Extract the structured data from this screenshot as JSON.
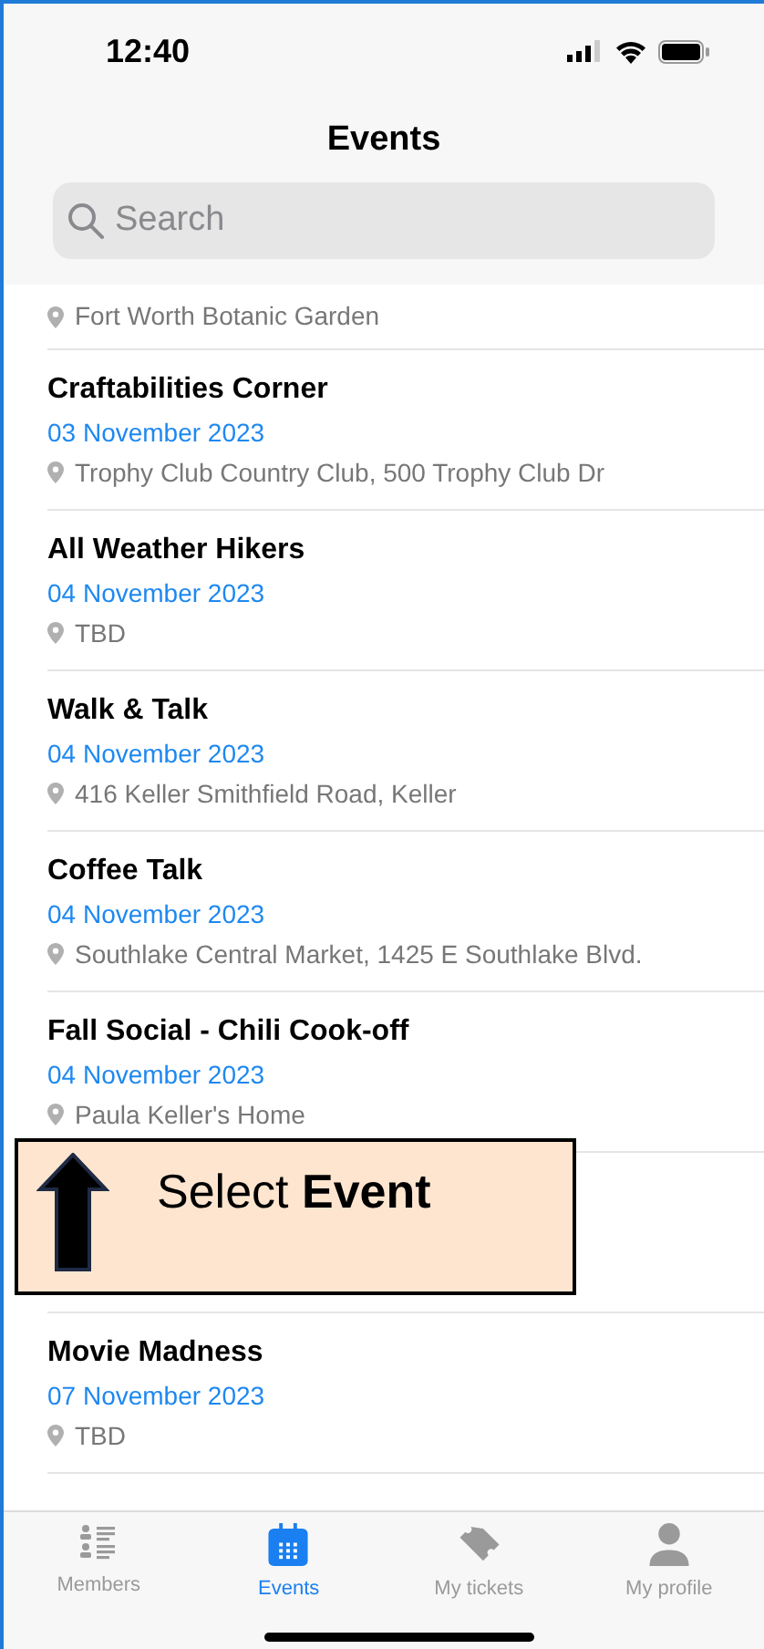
{
  "status_bar": {
    "time": "12:40"
  },
  "title": "Events",
  "search": {
    "placeholder": "Search"
  },
  "events": [
    {
      "kind": "partial",
      "location": "Fort Worth Botanic Garden"
    },
    {
      "kind": "event",
      "title": "Craftabilities Corner",
      "date": "03 November 2023",
      "location": "Trophy Club Country Club, 500 Trophy Club Dr"
    },
    {
      "kind": "event",
      "title": "All Weather Hikers",
      "date": "04 November 2023",
      "location": "TBD"
    },
    {
      "kind": "event",
      "title": "Walk & Talk",
      "date": "04 November 2023",
      "location": "416 Keller Smithfield Road, Keller"
    },
    {
      "kind": "event",
      "title": "Coffee Talk",
      "date": "04 November 2023",
      "location": "Southlake Central Market, 1425 E Southlake Blvd."
    },
    {
      "kind": "event",
      "title": "Fall Social - Chili Cook-off",
      "date": "04 November 2023",
      "location": "Paula Keller's Home"
    },
    {
      "kind": "hidden"
    },
    {
      "kind": "event",
      "title": "Movie Madness",
      "date": "07 November 2023",
      "location": "TBD"
    }
  ],
  "callout": {
    "text": "Select **Event**"
  },
  "tabs": [
    {
      "label": "Members",
      "selected": false
    },
    {
      "label": "Events",
      "selected": true
    },
    {
      "label": "My tickets",
      "selected": false
    },
    {
      "label": "My profile",
      "selected": false
    }
  ]
}
